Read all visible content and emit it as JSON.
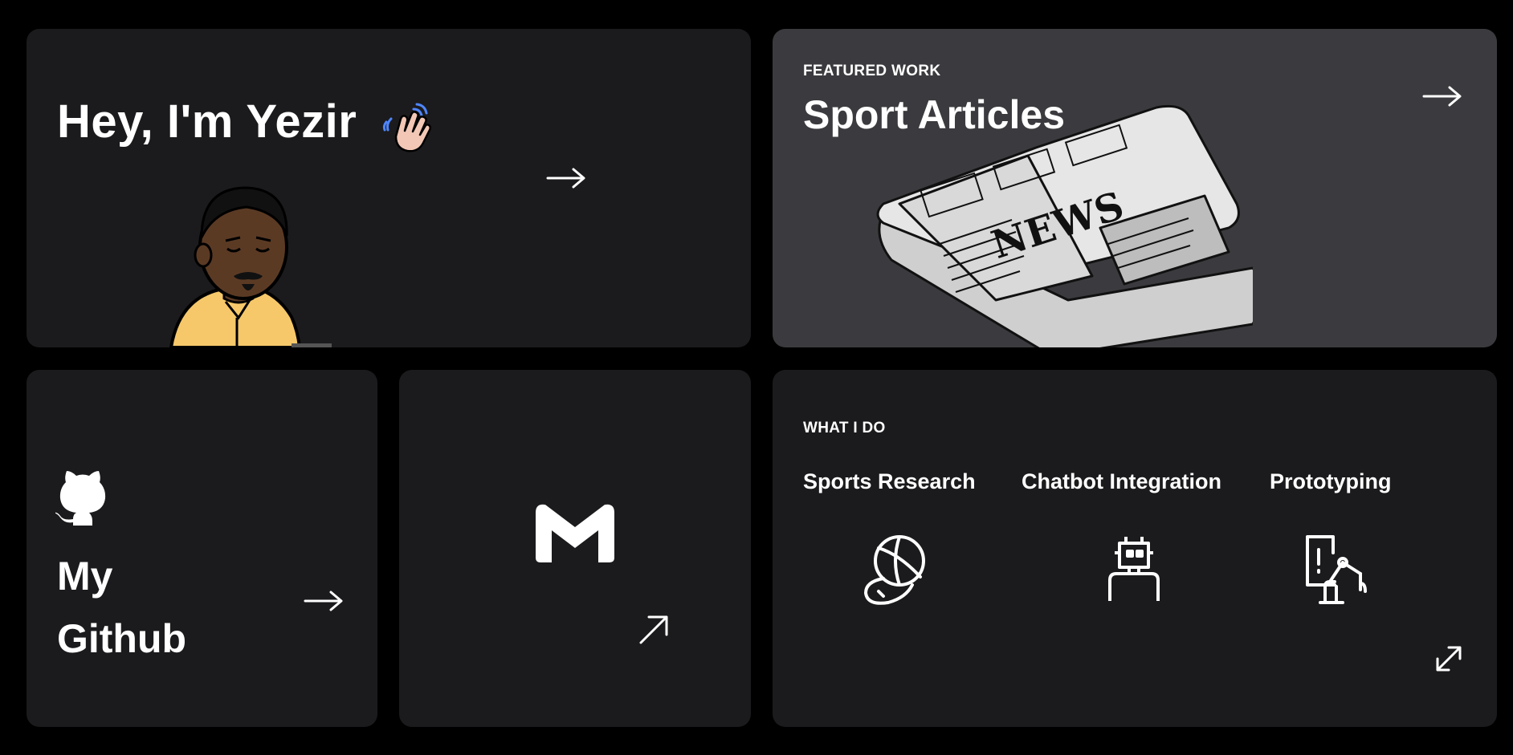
{
  "hero": {
    "title": "Hey, I'm Yezir",
    "wave_icon": "waving-hand-emoji",
    "avatar": "cartoon-avatar-man-yellow-shirt",
    "arrow_icon": "arrow-right-icon"
  },
  "featured": {
    "eyebrow": "FEATURED WORK",
    "title": "Sport Articles",
    "illustration": "newspaper-illustration",
    "arrow_icon": "arrow-right-icon"
  },
  "github": {
    "icon": "github-octocat-icon",
    "title_line1": "My",
    "title_line2": "Github",
    "arrow_icon": "arrow-right-icon"
  },
  "mail": {
    "icon": "gmail-m-icon",
    "arrow_icon": "arrow-up-right-icon"
  },
  "services": {
    "eyebrow": "WHAT I DO",
    "items": [
      {
        "label": "Sports Research",
        "icon": "sports-balls-icon"
      },
      {
        "label": "Chatbot Integration",
        "icon": "robot-icon"
      },
      {
        "label": "Prototyping",
        "icon": "prototype-robot-arm-icon"
      }
    ],
    "expand_icon": "expand-diagonal-icon"
  },
  "colors": {
    "page_bg": "#000000",
    "card_bg": "#1b1b1d",
    "featured_bg": "#3b3b3f",
    "text": "#ffffff",
    "avatar_shirt": "#f6c86a",
    "avatar_skin": "#5b3a24"
  }
}
